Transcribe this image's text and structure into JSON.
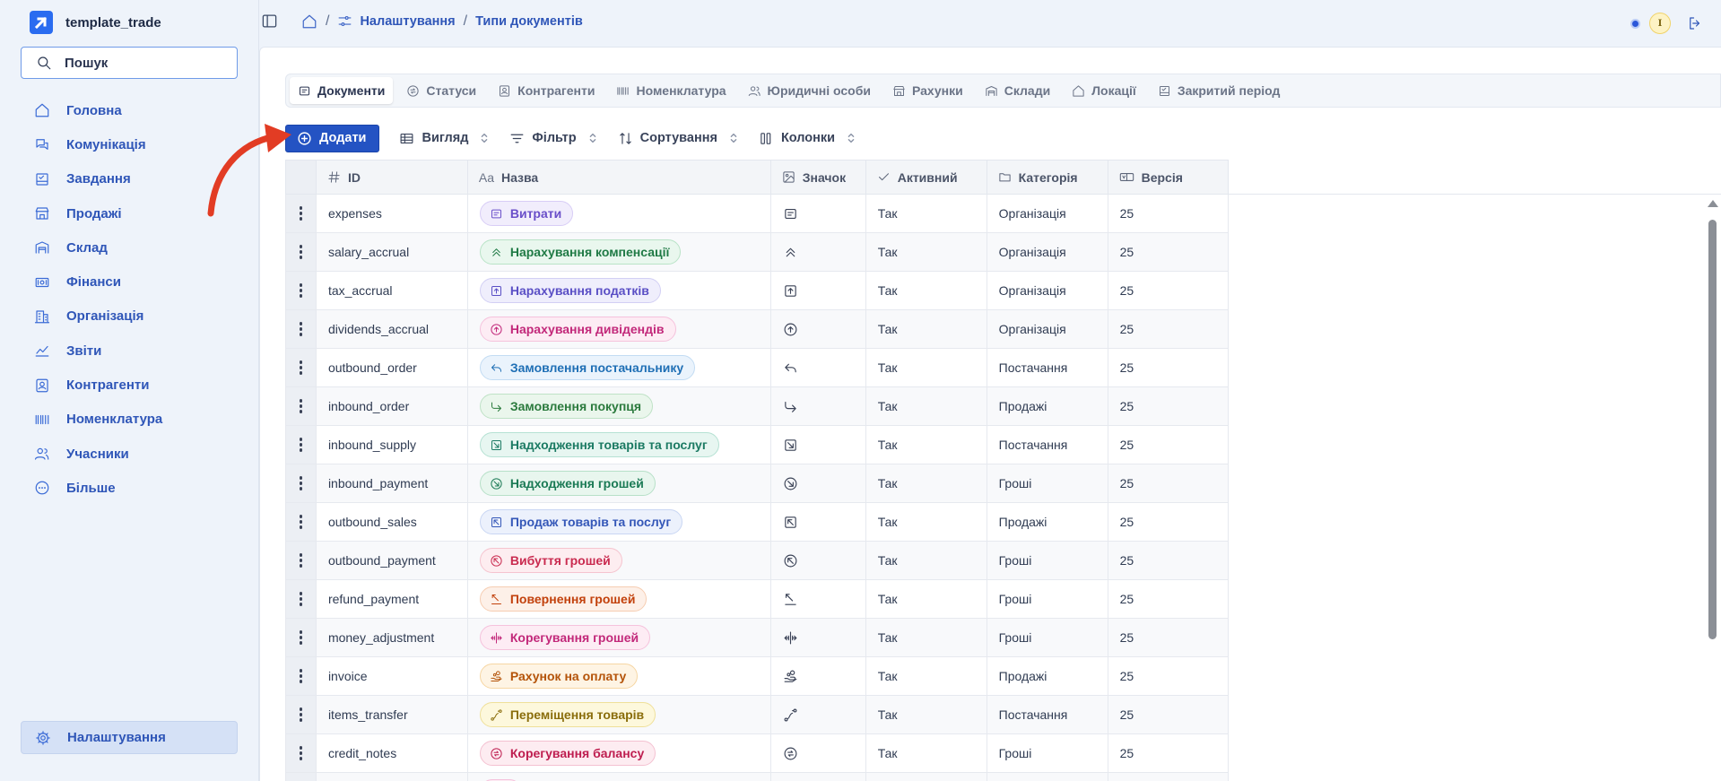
{
  "app": {
    "name": "template_trade"
  },
  "search": {
    "label": "Пошук"
  },
  "nav": [
    {
      "label": "Головна",
      "icon": "home-icon"
    },
    {
      "label": "Комунікація",
      "icon": "chat-icon"
    },
    {
      "label": "Завдання",
      "icon": "task-icon"
    },
    {
      "label": "Продажі",
      "icon": "store-icon"
    },
    {
      "label": "Склад",
      "icon": "warehouse-icon"
    },
    {
      "label": "Фінанси",
      "icon": "money-icon"
    },
    {
      "label": "Організація",
      "icon": "building-icon"
    },
    {
      "label": "Звіти",
      "icon": "chart-icon"
    },
    {
      "label": "Контрагенти",
      "icon": "contact-icon"
    },
    {
      "label": "Номенклатура",
      "icon": "barcode-icon"
    },
    {
      "label": "Учасники",
      "icon": "users-icon"
    },
    {
      "label": "Більше",
      "icon": "more-icon"
    }
  ],
  "settings": {
    "label": "Налаштування"
  },
  "breadcrumb": {
    "sep": "/",
    "settings": "Налаштування",
    "current": "Типи документів"
  },
  "user": {
    "initial": "I"
  },
  "tabs": [
    {
      "label": "Документи",
      "active": true
    },
    {
      "label": "Статуси"
    },
    {
      "label": "Контрагенти"
    },
    {
      "label": "Номенклатура"
    },
    {
      "label": "Юридичні особи"
    },
    {
      "label": "Рахунки"
    },
    {
      "label": "Склади"
    },
    {
      "label": "Локації"
    },
    {
      "label": "Закритий період"
    }
  ],
  "toolbar": {
    "add": "Додати",
    "view": "Вигляд",
    "filter": "Фільтр",
    "sort": "Сортування",
    "columns": "Колонки"
  },
  "columns": {
    "id": "ID",
    "name": "Назва",
    "icon": "Значок",
    "active": "Активний",
    "category": "Категорія",
    "version": "Версія",
    "name_prefix": "Aa"
  },
  "rows": [
    {
      "id": "expenses",
      "name": "Витрати",
      "icon": "receipt-icon",
      "active": "Так",
      "category": "Організація",
      "version": "25",
      "color": "#6a4fc9",
      "bg": "#f1edfc",
      "border": "#d8cdf6"
    },
    {
      "id": "salary_accrual",
      "name": "Нарахування компенсації",
      "icon": "chevrons-up-icon",
      "active": "Так",
      "category": "Організація",
      "version": "25",
      "color": "#1f7a45",
      "bg": "#e9f7ee",
      "border": "#b9e3c7"
    },
    {
      "id": "tax_accrual",
      "name": "Нарахування податків",
      "icon": "square-arrow-up-icon",
      "active": "Так",
      "category": "Організація",
      "version": "25",
      "color": "#5a4fc5",
      "bg": "#efeefc",
      "border": "#d2cff4"
    },
    {
      "id": "dividends_accrual",
      "name": "Нарахування дивідендів",
      "icon": "circle-arrow-up-icon",
      "active": "Так",
      "category": "Організація",
      "version": "25",
      "color": "#c2287a",
      "bg": "#fdecf4",
      "border": "#f5c2dc"
    },
    {
      "id": "outbound_order",
      "name": "Замовлення постачальнику",
      "icon": "reply-icon",
      "active": "Так",
      "category": "Постачання",
      "version": "25",
      "color": "#1f6fb5",
      "bg": "#eaf3fc",
      "border": "#c3dcf3"
    },
    {
      "id": "inbound_order",
      "name": "Замовлення покупця",
      "icon": "corner-down-right-icon",
      "active": "Так",
      "category": "Продажі",
      "version": "25",
      "color": "#2b7a3d",
      "bg": "#eaf6ec",
      "border": "#bfe2c6"
    },
    {
      "id": "inbound_supply",
      "name": "Надходження товарів та послуг",
      "icon": "square-arrow-down-right-icon",
      "active": "Так",
      "category": "Постачання",
      "version": "25",
      "color": "#1b7a63",
      "bg": "#e7f6f1",
      "border": "#b5e1d3"
    },
    {
      "id": "inbound_payment",
      "name": "Надходження грошей",
      "icon": "circle-arrow-down-right-icon",
      "active": "Так",
      "category": "Гроші",
      "version": "25",
      "color": "#1b7a55",
      "bg": "#e8f6ee",
      "border": "#b7e0c8"
    },
    {
      "id": "outbound_sales",
      "name": "Продаж товарів та послуг",
      "icon": "square-arrow-up-left-icon",
      "active": "Так",
      "category": "Продажі",
      "version": "25",
      "color": "#3457b8",
      "bg": "#ecf1fc",
      "border": "#c9d6f3"
    },
    {
      "id": "outbound_payment",
      "name": "Вибуття грошей",
      "icon": "circle-arrow-up-left-icon",
      "active": "Так",
      "category": "Гроші",
      "version": "25",
      "color": "#c92a4f",
      "bg": "#fdedf0",
      "border": "#f5c4cf"
    },
    {
      "id": "refund_payment",
      "name": "Повернення грошей",
      "icon": "arrow-up-left-from-line-icon",
      "active": "Так",
      "category": "Гроші",
      "version": "25",
      "color": "#c2410c",
      "bg": "#fdf0e8",
      "border": "#f6cdb2"
    },
    {
      "id": "money_adjustment",
      "name": "Корегування грошей",
      "icon": "split-horizontal-icon",
      "active": "Так",
      "category": "Гроші",
      "version": "25",
      "color": "#c2287a",
      "bg": "#fdecf4",
      "border": "#f5c2dc"
    },
    {
      "id": "invoice",
      "name": "Рахунок на оплату",
      "icon": "hand-coins-icon",
      "active": "Так",
      "category": "Продажі",
      "version": "25",
      "color": "#b45309",
      "bg": "#fef4e4",
      "border": "#f6d6a3"
    },
    {
      "id": "items_transfer",
      "name": "Переміщення товарів",
      "icon": "route-icon",
      "active": "Так",
      "category": "Постачання",
      "version": "25",
      "color": "#8a6d0b",
      "bg": "#fdf8dc",
      "border": "#efe09a"
    },
    {
      "id": "credit_notes",
      "name": "Корегування балансу",
      "icon": "circle-swap-icon",
      "active": "Так",
      "category": "Гроші",
      "version": "25",
      "color": "#be1d4f",
      "bg": "#fdecf1",
      "border": "#f4c1d1"
    },
    {
      "id": "",
      "name": "",
      "icon": "route-icon",
      "active": "",
      "category": "",
      "version": "",
      "color": "#c2287a",
      "bg": "#fdecf4",
      "border": "#f5c2dc"
    }
  ]
}
